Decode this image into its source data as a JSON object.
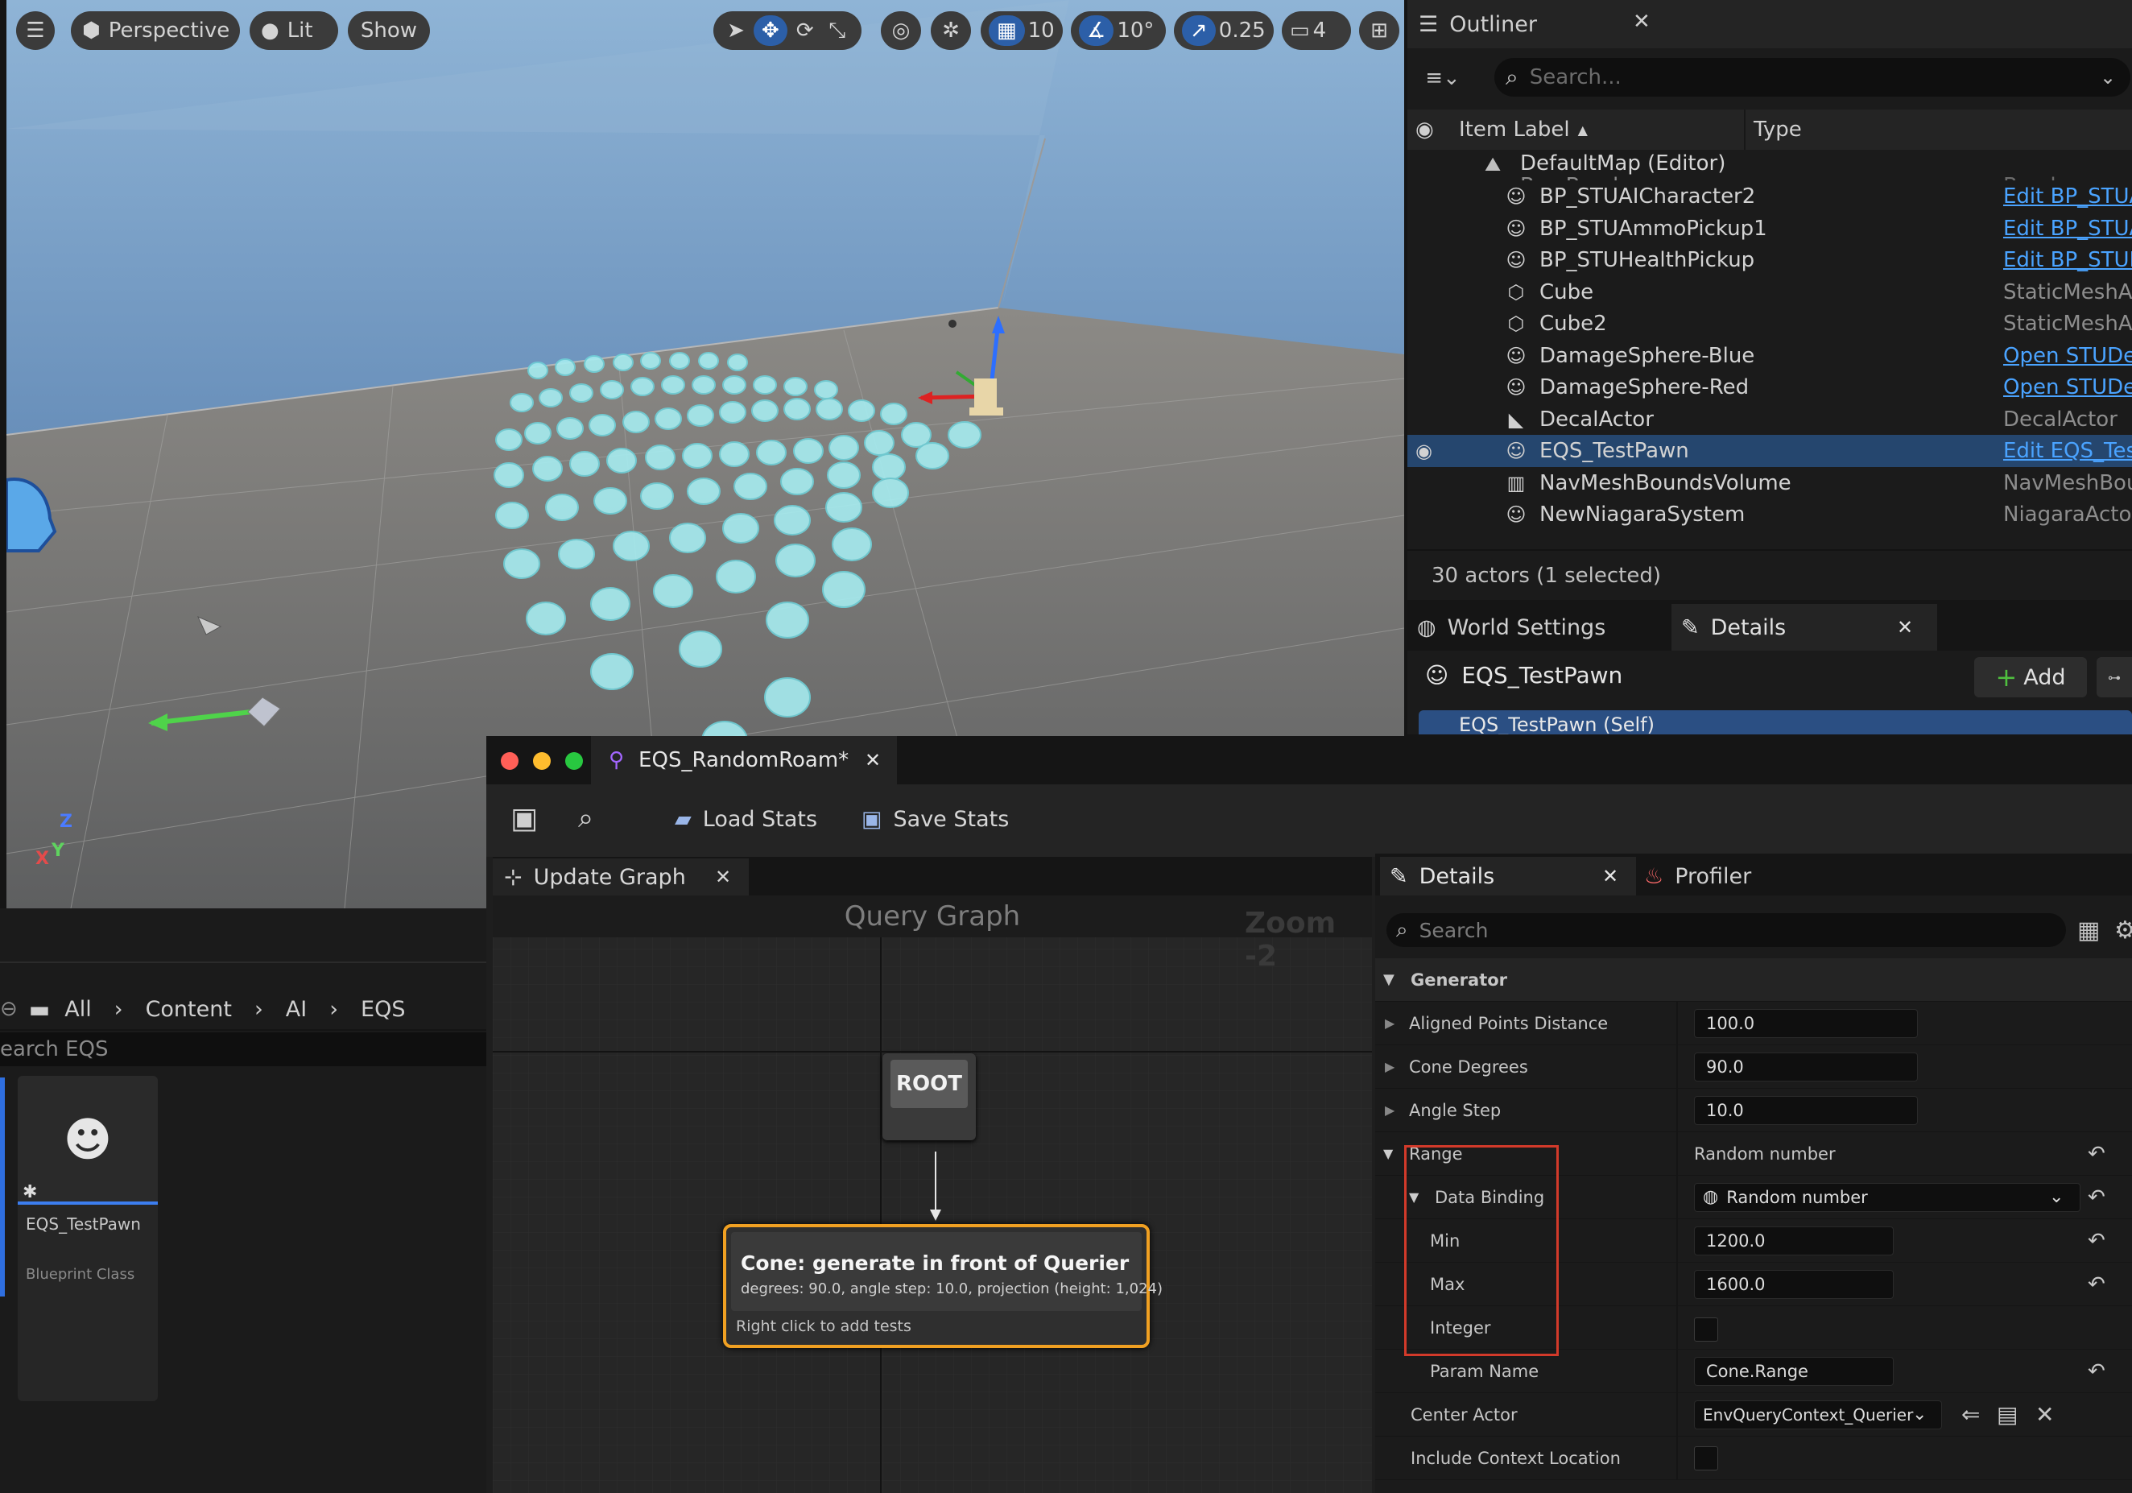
{
  "viewport": {
    "perspective_label": "Perspective",
    "lit_label": "Lit",
    "show_label": "Show",
    "grid_snap": "10",
    "rotation_snap": "10°",
    "scale_snap": "0.25",
    "camera_speed": "4",
    "axis_labels": {
      "z": "Z",
      "x": "X",
      "y": "Y"
    }
  },
  "outliner": {
    "tab_title": "Outliner",
    "search_placeholder": "Search...",
    "col_label": "Item Label",
    "col_type": "Type",
    "map_row": "DefaultMap (Editor)",
    "cut_row_label": "Box Brush",
    "cut_row_type": "Brush",
    "items": [
      {
        "label": "BP_STUAICharacter2",
        "type": "Edit BP_STUAI",
        "link": true
      },
      {
        "label": "BP_STUAmmoPickup1",
        "type": "Edit BP_STUA",
        "link": true
      },
      {
        "label": "BP_STUHealthPickup",
        "type": "Edit BP_STUH",
        "link": true
      },
      {
        "label": "Cube",
        "type": "StaticMeshAc",
        "link": false
      },
      {
        "label": "Cube2",
        "type": "StaticMeshAc",
        "link": false
      },
      {
        "label": "DamageSphere-Blue",
        "type": "Open STUDev",
        "link": true
      },
      {
        "label": "DamageSphere-Red",
        "type": "Open STUDev",
        "link": true
      },
      {
        "label": "DecalActor",
        "type": "DecalActor",
        "link": false
      },
      {
        "label": "EQS_TestPawn",
        "type": "Edit EQS_Tes",
        "link": true,
        "selected": true
      },
      {
        "label": "NavMeshBoundsVolume",
        "type": "NavMeshBou",
        "link": false
      },
      {
        "label": "NewNiagaraSystem",
        "type": "NiagaraActor",
        "link": false
      }
    ],
    "status": "30 actors (1 selected)"
  },
  "world_details": {
    "tab_world": "World Settings",
    "tab_details": "Details",
    "actor_name": "EQS_TestPawn",
    "add_label": "Add",
    "self_row": "EQS_TestPawn (Self)"
  },
  "content_browser": {
    "crumbs": [
      "All",
      "Content",
      "AI",
      "EQS"
    ],
    "search_placeholder": "earch EQS",
    "asset_name": "EQS_TestPawn",
    "asset_type": "Blueprint Class"
  },
  "eqs_editor": {
    "tab_title": "EQS_RandomRoam*",
    "load_stats": "Load Stats",
    "save_stats": "Save Stats",
    "update_graph_tab": "Update Graph",
    "graph_title": "Query Graph",
    "zoom_label": "Zoom -2",
    "root_label": "ROOT",
    "node_title": "Cone: generate in front of Querier",
    "node_subtitle": "degrees: 90.0, angle step: 10.0, projection (height: 1,024)",
    "node_hint": "Right click to add tests"
  },
  "details": {
    "tab_details": "Details",
    "tab_profiler": "Profiler",
    "search_placeholder": "Search",
    "section": "Generator",
    "aligned_points_distance": {
      "label": "Aligned Points Distance",
      "value": "100.0"
    },
    "cone_degrees": {
      "label": "Cone Degrees",
      "value": "90.0"
    },
    "angle_step": {
      "label": "Angle Step",
      "value": "10.0"
    },
    "range": {
      "label": "Range",
      "value": "Random number"
    },
    "data_binding": {
      "label": "Data Binding",
      "value": "Random number"
    },
    "min": {
      "label": "Min",
      "value": "1200.0"
    },
    "max": {
      "label": "Max",
      "value": "1600.0"
    },
    "integer": {
      "label": "Integer"
    },
    "param_name": {
      "label": "Param Name",
      "value": "Cone.Range"
    },
    "center_actor": {
      "label": "Center Actor",
      "value": "EnvQueryContext_Querier"
    },
    "include_context": {
      "label": "Include Context Location"
    }
  },
  "colors": {
    "accent_blue": "#2c5fa8",
    "highlight_red": "#d23a2a",
    "node_orange": "#f0a022",
    "selection": "#25466e"
  }
}
